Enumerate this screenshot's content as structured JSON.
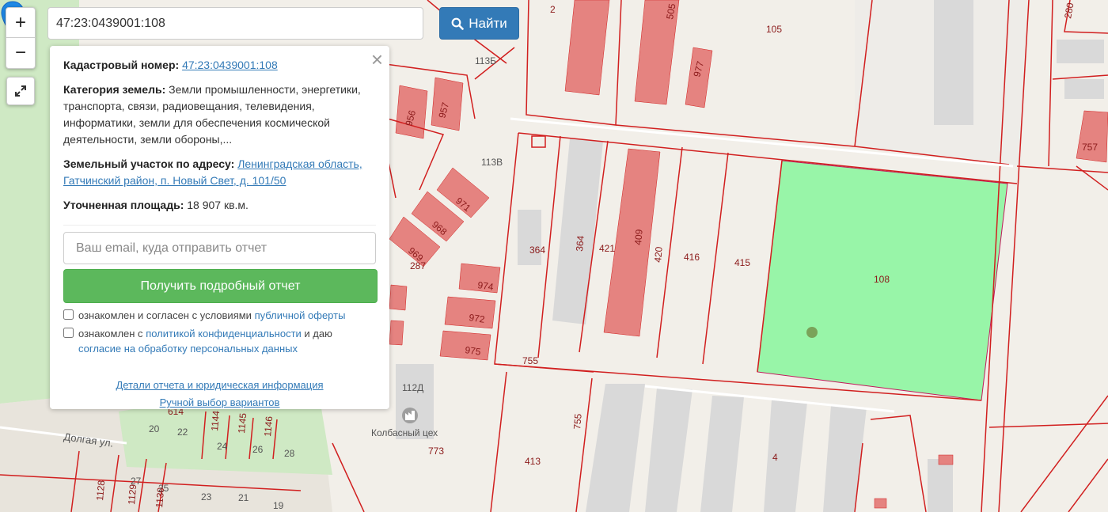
{
  "search": {
    "value": "47:23:0439001:108",
    "button_label": "Найти",
    "button_icon": "search-icon"
  },
  "controls": {
    "zoom_in": "+",
    "zoom_out": "−",
    "fullscreen_icon": "expand-icon"
  },
  "panel": {
    "cadastral_label": "Кадастровый номер:",
    "cadastral_value": "47:23:0439001:108",
    "category_label": "Категория земель:",
    "category_value": "Земли промышленности, энергетики, транспорта, связи, радиовещания, телевидения, информатики, земли для обеспечения космической деятельности, земли обороны,...",
    "address_label": "Земельный участок по адресу:",
    "address_value": "Ленинградская область, Гатчинский район, п. Новый Свет, д. 101/50",
    "area_label": "Уточненная площадь:",
    "area_value": "18 907 кв.м.",
    "email_placeholder": "Ваш email, куда отправить отчет",
    "report_button": "Получить подробный отчет",
    "terms_text": "ознакомлен и согласен с условиями",
    "terms_link": "публичной оферты",
    "privacy_text_1": "ознакомлен с",
    "privacy_link": "политикой конфиденциальности",
    "privacy_text_2": "и даю",
    "privacy_link_2": "согласие на обработку персональных данных",
    "details_link": "Детали отчета и юридическая информация",
    "manual_link": "Ручной выбор вариантов"
  },
  "map": {
    "plot_labels": [
      "105",
      "2",
      "977",
      "113Б",
      "113В",
      "956",
      "957",
      "971",
      "968",
      "969",
      "287",
      "364",
      "364",
      "421",
      "409",
      "420",
      "416",
      "415",
      "108",
      "974",
      "972",
      "975",
      "755",
      "755",
      "112Д",
      "773",
      "413",
      "4",
      "614",
      "1144",
      "1145",
      "1146",
      "20",
      "22",
      "24",
      "26",
      "28",
      "1128",
      "1129",
      "1130",
      "27",
      "25",
      "23",
      "21",
      "19",
      "280",
      "757",
      "505"
    ],
    "poi_label": "Колбасный цех",
    "street_label": "Долгая ул.",
    "selected_plot_label": "108",
    "colors": {
      "selected_fill": "#98f5a8",
      "building_fill": "#e58380",
      "boundary": "#d11f1f",
      "marker": "#1e88e5"
    }
  }
}
